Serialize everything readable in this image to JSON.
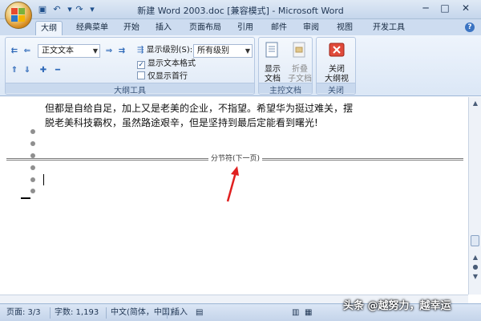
{
  "window": {
    "title": "新建 Word 2003.doc [兼容模式] - Microsoft Word",
    "controls": {
      "minimize": "─",
      "maximize": "□",
      "close": "✕"
    }
  },
  "quick_access": {
    "save_icon": "save-icon",
    "undo_icon": "undo-icon",
    "redo_icon": "redo-icon",
    "more_icon": "customize-icon"
  },
  "tabs": [
    "大纲",
    "经典菜单",
    "开始",
    "插入",
    "页面布局",
    "引用",
    "邮件",
    "审阅",
    "视图",
    "开发工具"
  ],
  "ribbon": {
    "outline_tools": {
      "label": "大纲工具",
      "level_select": "正文文本",
      "show_level_label": "显示级别(S):",
      "show_level_value": "所有级别",
      "show_text_format": "显示文本格式",
      "first_line_only": "仅显示首行",
      "show_text_format_checked": true,
      "first_line_only_checked": false
    },
    "master_doc": {
      "label": "主控文档",
      "show_doc": [
        "显示",
        "文档"
      ],
      "collapse_subdocs": [
        "折叠",
        "子文档"
      ]
    },
    "close": {
      "label": "关闭",
      "close_outline": [
        "关闭",
        "大纲视图"
      ]
    }
  },
  "document": {
    "line1": "但都是自给自足，加上又是老美的企业，不指望。希望华为挺过难关，摆",
    "line2": "脱老美科技霸权，虽然路途艰辛，但是坚持到最后定能看到曙光!",
    "section_break": "分节符(下一页)",
    "annotation_color": "#e02020"
  },
  "status": {
    "page": "页面: 3/3",
    "words": "字数: 1,193",
    "language": "中文(简体，中国)",
    "mode": "插入"
  },
  "watermark": "头条 @越努力，越幸运"
}
